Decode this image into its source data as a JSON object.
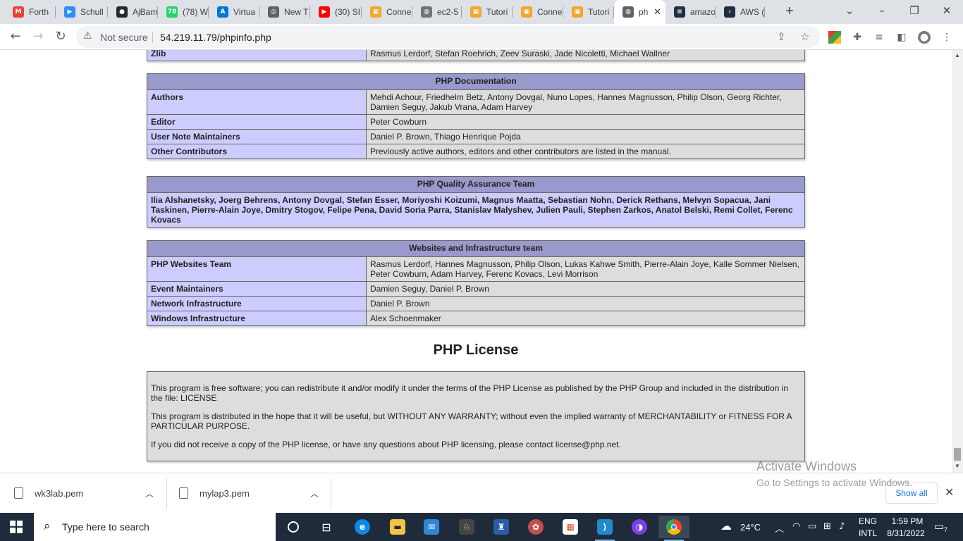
{
  "browser": {
    "tabs": [
      {
        "title": "Forth",
        "icon": "gmail-icon",
        "color": "#ea4335",
        "glyph": "M"
      },
      {
        "title": "Schull",
        "icon": "zoom-icon",
        "color": "#2d8cff",
        "glyph": "▶"
      },
      {
        "title": "AjBam",
        "icon": "github-icon",
        "color": "#24292e",
        "glyph": "●"
      },
      {
        "title": "(78) W",
        "icon": "whatsapp-icon",
        "color": "#25d366",
        "glyph": "78"
      },
      {
        "title": "Virtua",
        "icon": "azure-icon",
        "color": "#0078d4",
        "glyph": "A"
      },
      {
        "title": "New T",
        "icon": "chrome-icon",
        "color": "#5f6368",
        "glyph": "◎"
      },
      {
        "title": "(30) SI",
        "icon": "youtube-icon",
        "color": "#ff0000",
        "glyph": "▶"
      },
      {
        "title": "Conne",
        "icon": "aws-box-icon",
        "color": "#f0a830",
        "glyph": "▣"
      },
      {
        "title": "ec2-5",
        "icon": "globe-icon",
        "color": "#70757a",
        "glyph": "◍"
      },
      {
        "title": "Tutori",
        "icon": "aws-box-icon",
        "color": "#f0a830",
        "glyph": "▣"
      },
      {
        "title": "Conne",
        "icon": "aws-box-icon",
        "color": "#f0a830",
        "glyph": "▣"
      },
      {
        "title": "Tutori",
        "icon": "aws-box-icon",
        "color": "#f0a830",
        "glyph": "▣"
      },
      {
        "title": "ph",
        "icon": "globe-icon",
        "color": "#5f6368",
        "glyph": "◍",
        "active": true
      },
      {
        "title": "amazo",
        "icon": "amazon-icon",
        "color": "#232f3e",
        "glyph": "≡"
      },
      {
        "title": "AWS (",
        "icon": "terminal-icon",
        "color": "#232f3e",
        "glyph": "›"
      }
    ],
    "not_secure": "Not secure",
    "url": "54.219.11.79/phpinfo.php"
  },
  "page": {
    "zlib": {
      "key": "Zlib",
      "value": "Rasmus Lerdorf, Stefan Roehrich, Zeev Suraski, Jade Nicoletti, Michael Wallner"
    },
    "documentation": {
      "header": "PHP Documentation",
      "rows": [
        {
          "key": "Authors",
          "value": "Mehdi Achour, Friedhelm Betz, Antony Dovgal, Nuno Lopes, Hannes Magnusson, Philip Olson, Georg Richter, Damien Seguy, Jakub Vrana, Adam Harvey"
        },
        {
          "key": "Editor",
          "value": "Peter Cowburn"
        },
        {
          "key": "User Note Maintainers",
          "value": "Daniel P. Brown, Thiago Henrique Pojda"
        },
        {
          "key": "Other Contributors",
          "value": "Previously active authors, editors and other contributors are listed in the manual."
        }
      ]
    },
    "qa": {
      "header": "PHP Quality Assurance Team",
      "members": "Ilia Alshanetsky, Joerg Behrens, Antony Dovgal, Stefan Esser, Moriyoshi Koizumi, Magnus Maatta, Sebastian Nohn, Derick Rethans, Melvyn Sopacua, Jani Taskinen, Pierre-Alain Joye, Dmitry Stogov, Felipe Pena, David Soria Parra, Stanislav Malyshev, Julien Pauli, Stephen Zarkos, Anatol Belski, Remi Collet, Ferenc Kovacs"
    },
    "websites": {
      "header": "Websites and Infrastructure team",
      "rows": [
        {
          "key": "PHP Websites Team",
          "value": "Rasmus Lerdorf, Hannes Magnusson, Philip Olson, Lukas Kahwe Smith, Pierre-Alain Joye, Kalle Sommer Nielsen, Peter Cowburn, Adam Harvey, Ferenc Kovacs, Levi Morrison"
        },
        {
          "key": "Event Maintainers",
          "value": "Damien Seguy, Daniel P. Brown"
        },
        {
          "key": "Network Infrastructure",
          "value": "Daniel P. Brown"
        },
        {
          "key": "Windows Infrastructure",
          "value": "Alex Schoenmaker"
        }
      ]
    },
    "license": {
      "title": "PHP License",
      "paragraphs": [
        "This program is free software; you can redistribute it and/or modify it under the terms of the PHP License as published by the PHP Group and included in the distribution in the file: LICENSE",
        "This program is distributed in the hope that it will be useful, but WITHOUT ANY WARRANTY; without even the implied warranty of MERCHANTABILITY or FITNESS FOR A PARTICULAR PURPOSE.",
        "If you did not receive a copy of the PHP license, or have any questions about PHP licensing, please contact license@php.net."
      ]
    }
  },
  "downloads": {
    "items": [
      "wk3lab.pem",
      "mylap3.pem"
    ],
    "show_all": "Show all"
  },
  "watermark": {
    "line1": "Activate Windows",
    "line2": "Go to Settings to activate Windows."
  },
  "taskbar": {
    "search_placeholder": "Type here to search",
    "weather": "24°C",
    "lang1": "ENG",
    "lang2": "INTL",
    "time": "1:59 PM",
    "date": "8/31/2022",
    "notifications": "7"
  }
}
